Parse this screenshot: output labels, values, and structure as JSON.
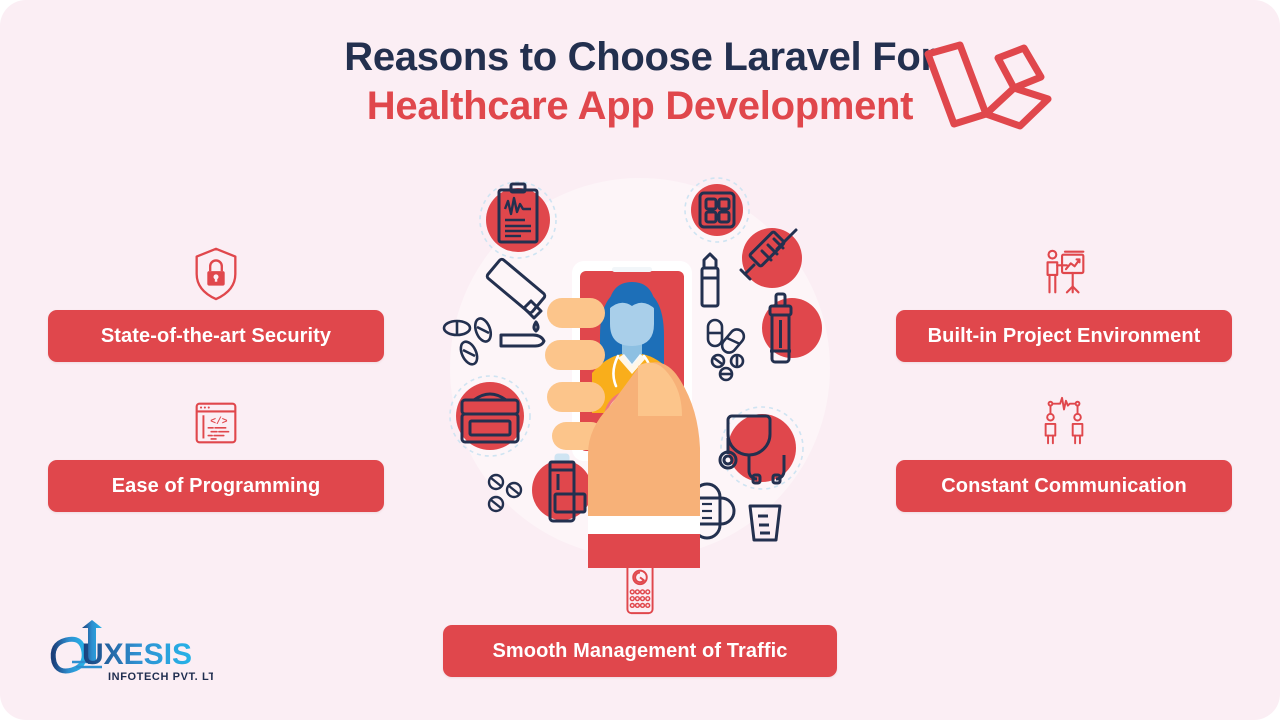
{
  "page": {
    "background_color": "#fbeef4",
    "accent_red": "#e0474c",
    "navy": "#23304f"
  },
  "header": {
    "title_line1": "Reasons to Choose Laravel For",
    "title_line2": "Healthcare App Development",
    "logo_name": "laravel-logo"
  },
  "features": [
    {
      "id": "security",
      "label": "State-of-the-art Security",
      "icon": "shield-lock-icon",
      "side": "left"
    },
    {
      "id": "ease",
      "label": "Ease of Programming",
      "icon": "code-window-icon",
      "side": "left"
    },
    {
      "id": "builtin",
      "label": "Built-in Project Environment",
      "icon": "presentation-board-icon",
      "side": "right"
    },
    {
      "id": "communication",
      "label": "Constant Communication",
      "icon": "two-people-pulse-icon",
      "side": "right"
    },
    {
      "id": "traffic",
      "label": "Smooth Management of Traffic",
      "icon": "phone-keypad-icon",
      "side": "bottom"
    }
  ],
  "illustration": {
    "name": "telemedicine-hand-holding-phone",
    "description": "Hand holding a smartphone showing a female doctor, surrounded by medical icons",
    "colors": {
      "phone_body": "#ffffff",
      "phone_screen": "#e0474c",
      "skin": "#f7b178",
      "skin_light": "#fcc58b",
      "hair": "#1d6fb8",
      "face": "#a9cfea",
      "coat": "#f9ae1b",
      "icon_navy": "#23304f",
      "circle_red": "#e0474c",
      "dashed_ring": "#cfe4f2",
      "backdrop": "#fdf5f8"
    },
    "icons": [
      "clipboard-ecg-icon",
      "pill-pack-icon",
      "syringe-icon",
      "dropper-bottle-icon",
      "ampoule-icon",
      "capsules-icon",
      "medicine-tube-spoon-icon",
      "tablets-icon",
      "first-aid-kit-icon",
      "medicine-bottle-icon",
      "stethoscope-icon",
      "bandage-icon",
      "measuring-cup-icon"
    ]
  },
  "brand": {
    "name": "Auxesis Infotech",
    "wordmark": "UXESIS",
    "tagline": "INFOTECH PVT. LTD."
  }
}
